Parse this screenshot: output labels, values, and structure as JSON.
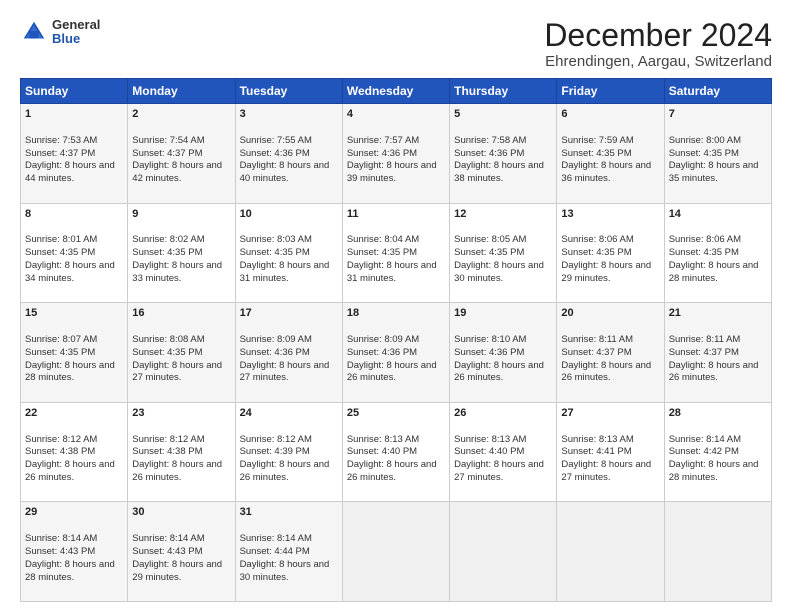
{
  "header": {
    "title": "December 2024",
    "subtitle": "Ehrendingen, Aargau, Switzerland",
    "logo_general": "General",
    "logo_blue": "Blue"
  },
  "days_of_week": [
    "Sunday",
    "Monday",
    "Tuesday",
    "Wednesday",
    "Thursday",
    "Friday",
    "Saturday"
  ],
  "weeks": [
    [
      {
        "day": "1",
        "sunrise": "Sunrise: 7:53 AM",
        "sunset": "Sunset: 4:37 PM",
        "daylight": "Daylight: 8 hours and 44 minutes."
      },
      {
        "day": "2",
        "sunrise": "Sunrise: 7:54 AM",
        "sunset": "Sunset: 4:37 PM",
        "daylight": "Daylight: 8 hours and 42 minutes."
      },
      {
        "day": "3",
        "sunrise": "Sunrise: 7:55 AM",
        "sunset": "Sunset: 4:36 PM",
        "daylight": "Daylight: 8 hours and 40 minutes."
      },
      {
        "day": "4",
        "sunrise": "Sunrise: 7:57 AM",
        "sunset": "Sunset: 4:36 PM",
        "daylight": "Daylight: 8 hours and 39 minutes."
      },
      {
        "day": "5",
        "sunrise": "Sunrise: 7:58 AM",
        "sunset": "Sunset: 4:36 PM",
        "daylight": "Daylight: 8 hours and 38 minutes."
      },
      {
        "day": "6",
        "sunrise": "Sunrise: 7:59 AM",
        "sunset": "Sunset: 4:35 PM",
        "daylight": "Daylight: 8 hours and 36 minutes."
      },
      {
        "day": "7",
        "sunrise": "Sunrise: 8:00 AM",
        "sunset": "Sunset: 4:35 PM",
        "daylight": "Daylight: 8 hours and 35 minutes."
      }
    ],
    [
      {
        "day": "8",
        "sunrise": "Sunrise: 8:01 AM",
        "sunset": "Sunset: 4:35 PM",
        "daylight": "Daylight: 8 hours and 34 minutes."
      },
      {
        "day": "9",
        "sunrise": "Sunrise: 8:02 AM",
        "sunset": "Sunset: 4:35 PM",
        "daylight": "Daylight: 8 hours and 33 minutes."
      },
      {
        "day": "10",
        "sunrise": "Sunrise: 8:03 AM",
        "sunset": "Sunset: 4:35 PM",
        "daylight": "Daylight: 8 hours and 31 minutes."
      },
      {
        "day": "11",
        "sunrise": "Sunrise: 8:04 AM",
        "sunset": "Sunset: 4:35 PM",
        "daylight": "Daylight: 8 hours and 31 minutes."
      },
      {
        "day": "12",
        "sunrise": "Sunrise: 8:05 AM",
        "sunset": "Sunset: 4:35 PM",
        "daylight": "Daylight: 8 hours and 30 minutes."
      },
      {
        "day": "13",
        "sunrise": "Sunrise: 8:06 AM",
        "sunset": "Sunset: 4:35 PM",
        "daylight": "Daylight: 8 hours and 29 minutes."
      },
      {
        "day": "14",
        "sunrise": "Sunrise: 8:06 AM",
        "sunset": "Sunset: 4:35 PM",
        "daylight": "Daylight: 8 hours and 28 minutes."
      }
    ],
    [
      {
        "day": "15",
        "sunrise": "Sunrise: 8:07 AM",
        "sunset": "Sunset: 4:35 PM",
        "daylight": "Daylight: 8 hours and 28 minutes."
      },
      {
        "day": "16",
        "sunrise": "Sunrise: 8:08 AM",
        "sunset": "Sunset: 4:35 PM",
        "daylight": "Daylight: 8 hours and 27 minutes."
      },
      {
        "day": "17",
        "sunrise": "Sunrise: 8:09 AM",
        "sunset": "Sunset: 4:36 PM",
        "daylight": "Daylight: 8 hours and 27 minutes."
      },
      {
        "day": "18",
        "sunrise": "Sunrise: 8:09 AM",
        "sunset": "Sunset: 4:36 PM",
        "daylight": "Daylight: 8 hours and 26 minutes."
      },
      {
        "day": "19",
        "sunrise": "Sunrise: 8:10 AM",
        "sunset": "Sunset: 4:36 PM",
        "daylight": "Daylight: 8 hours and 26 minutes."
      },
      {
        "day": "20",
        "sunrise": "Sunrise: 8:11 AM",
        "sunset": "Sunset: 4:37 PM",
        "daylight": "Daylight: 8 hours and 26 minutes."
      },
      {
        "day": "21",
        "sunrise": "Sunrise: 8:11 AM",
        "sunset": "Sunset: 4:37 PM",
        "daylight": "Daylight: 8 hours and 26 minutes."
      }
    ],
    [
      {
        "day": "22",
        "sunrise": "Sunrise: 8:12 AM",
        "sunset": "Sunset: 4:38 PM",
        "daylight": "Daylight: 8 hours and 26 minutes."
      },
      {
        "day": "23",
        "sunrise": "Sunrise: 8:12 AM",
        "sunset": "Sunset: 4:38 PM",
        "daylight": "Daylight: 8 hours and 26 minutes."
      },
      {
        "day": "24",
        "sunrise": "Sunrise: 8:12 AM",
        "sunset": "Sunset: 4:39 PM",
        "daylight": "Daylight: 8 hours and 26 minutes."
      },
      {
        "day": "25",
        "sunrise": "Sunrise: 8:13 AM",
        "sunset": "Sunset: 4:40 PM",
        "daylight": "Daylight: 8 hours and 26 minutes."
      },
      {
        "day": "26",
        "sunrise": "Sunrise: 8:13 AM",
        "sunset": "Sunset: 4:40 PM",
        "daylight": "Daylight: 8 hours and 27 minutes."
      },
      {
        "day": "27",
        "sunrise": "Sunrise: 8:13 AM",
        "sunset": "Sunset: 4:41 PM",
        "daylight": "Daylight: 8 hours and 27 minutes."
      },
      {
        "day": "28",
        "sunrise": "Sunrise: 8:14 AM",
        "sunset": "Sunset: 4:42 PM",
        "daylight": "Daylight: 8 hours and 28 minutes."
      }
    ],
    [
      {
        "day": "29",
        "sunrise": "Sunrise: 8:14 AM",
        "sunset": "Sunset: 4:43 PM",
        "daylight": "Daylight: 8 hours and 28 minutes."
      },
      {
        "day": "30",
        "sunrise": "Sunrise: 8:14 AM",
        "sunset": "Sunset: 4:43 PM",
        "daylight": "Daylight: 8 hours and 29 minutes."
      },
      {
        "day": "31",
        "sunrise": "Sunrise: 8:14 AM",
        "sunset": "Sunset: 4:44 PM",
        "daylight": "Daylight: 8 hours and 30 minutes."
      },
      null,
      null,
      null,
      null
    ]
  ]
}
